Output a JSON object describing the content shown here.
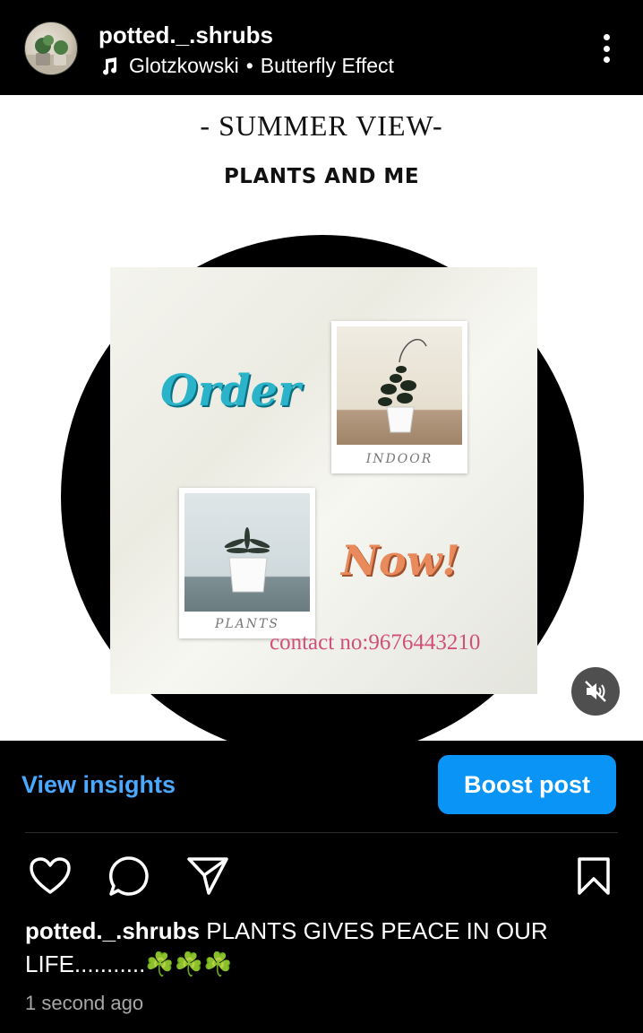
{
  "header": {
    "username": "potted._.shrubs",
    "artist": "Glotzkowski",
    "separator": "•",
    "song": "Butterfly Effect",
    "icons": {
      "music": "music-note-icon",
      "more": "more-vertical-icon"
    }
  },
  "post": {
    "title": "- SUMMER VIEW-",
    "subtitle": "PLANTS AND ME",
    "order_text": "Order",
    "now_text": "Now!",
    "contact_text": "contact no:9676443210",
    "polaroid_top_caption": "INDOOR",
    "polaroid_bottom_caption": "PLANTS",
    "mute_icon": "muted-speaker-icon"
  },
  "insights": {
    "view_label": "View insights",
    "boost_label": "Boost post"
  },
  "actions": {
    "icons": [
      "heart-icon",
      "comment-icon",
      "share-icon",
      "bookmark-icon"
    ]
  },
  "caption": {
    "username": "potted._.shrubs",
    "text": " PLANTS GIVES PEACE IN OUR LIFE...........☘️☘️☘️"
  },
  "timestamp": "1 second ago",
  "colors": {
    "link": "#4aa8ff",
    "boost": "#0a95f6",
    "order": "#2bb3c9",
    "now": "#e98a5c",
    "contact": "#d24f7c"
  }
}
